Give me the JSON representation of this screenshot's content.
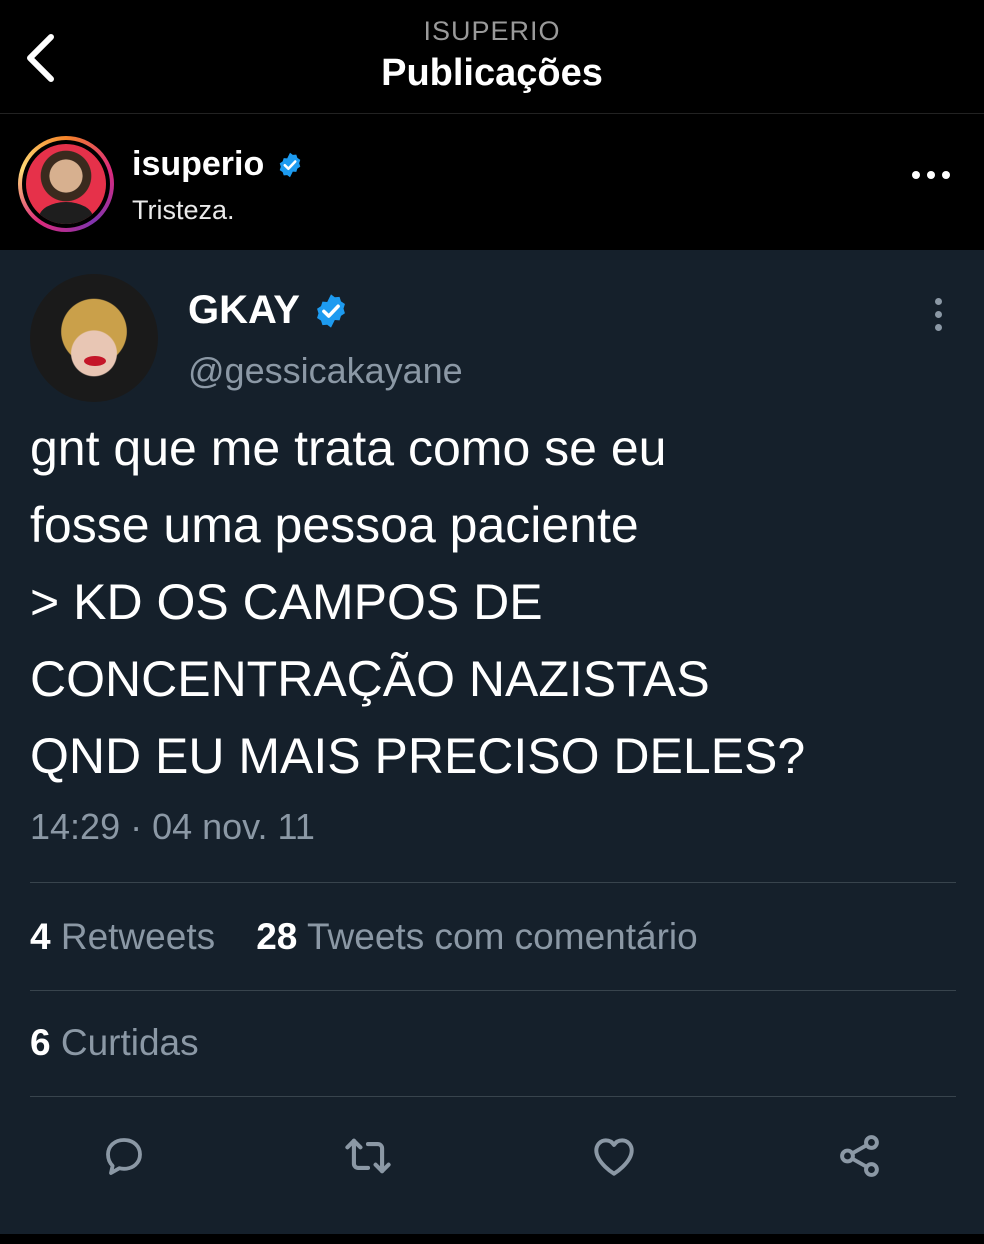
{
  "nav": {
    "account": "ISUPERIO",
    "title": "Publicações"
  },
  "post": {
    "username": "isuperio",
    "caption": "Tristeza."
  },
  "tweet": {
    "name": "GKAY",
    "handle": "@gessicakayane",
    "text_lines": [
      "gnt que me trata como se eu",
      "fosse uma pessoa paciente",
      "> KD OS CAMPOS DE",
      "CONCENTRAÇÃO NAZISTAS",
      "QND EU MAIS PRECISO DELES?"
    ],
    "timestamp": "14:29 · 04 nov. 11",
    "retweets_count": "4",
    "retweets_label": "Retweets",
    "quotes_count": "28",
    "quotes_label": "Tweets com comentário",
    "likes_count": "6",
    "likes_label": "Curtidas"
  },
  "icons": {
    "back": "chevron-left-icon",
    "verified": "verified-badge-icon",
    "more_horizontal": "more-horizontal-icon",
    "more_vertical": "more-vertical-icon",
    "reply": "reply-icon",
    "retweet": "retweet-icon",
    "like": "heart-icon",
    "share": "share-icon"
  },
  "colors": {
    "tweet_bg": "#15202b",
    "verified": "#1d9bf0",
    "muted": "#8b98a5"
  }
}
